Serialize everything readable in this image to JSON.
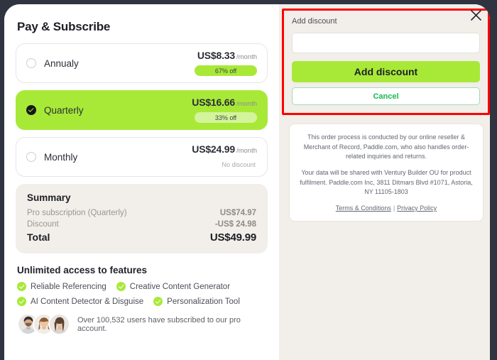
{
  "left_panel": {
    "title": "Pay & Subscribe",
    "plans": [
      {
        "name": "Annualy",
        "price": "US$8.33",
        "period": "/month",
        "badge": "67% off",
        "selected": false
      },
      {
        "name": "Quarterly",
        "price": "US$16.66",
        "period": "/month",
        "badge": "33% off",
        "selected": true
      },
      {
        "name": "Monthly",
        "price": "US$24.99",
        "period": "/month",
        "badge": "No discount",
        "selected": false
      }
    ],
    "summary": {
      "heading": "Summary",
      "rows": [
        {
          "label": "Pro subscription (Quarterly)",
          "value": "US$74.97"
        },
        {
          "label": "Discount",
          "value": "-US$ 24.98"
        }
      ],
      "total_label": "Total",
      "total_value": "US$49.99"
    },
    "features": {
      "heading": "Unlimited access to features",
      "items": [
        "Reliable Referencing",
        "Creative Content Generator",
        "AI Content Detector & Disguise",
        "Personalization Tool"
      ]
    },
    "social_proof": "Over 100,532 users have subscribed to our pro account."
  },
  "right_panel": {
    "discount": {
      "label": "Add discount",
      "input_value": "",
      "input_placeholder": "",
      "submit_label": "Add discount",
      "cancel_label": "Cancel",
      "close_icon": "close-icon",
      "highlight_color": "#fe0000"
    },
    "legal": {
      "paragraph_1": "This order process is conducted by our online reseller & Merchant of Record, Paddle.com, who also handles order-related inquiries and returns.",
      "paragraph_2": "Your data will be shared with Ventury Builder OU for product fulfilment. Paddle.com Inc, 3811 Ditmars Blvd #1071, Astoria, NY 11105-1803",
      "terms_label": "Terms & Conditions",
      "separator": "|",
      "privacy_label": "Privacy Policy"
    }
  },
  "colors": {
    "accent_green": "#a8e938",
    "panel_beige": "#f2eee9",
    "highlight_red": "#fe0000",
    "link_green": "#17ba53",
    "backdrop": "#2f3440"
  }
}
